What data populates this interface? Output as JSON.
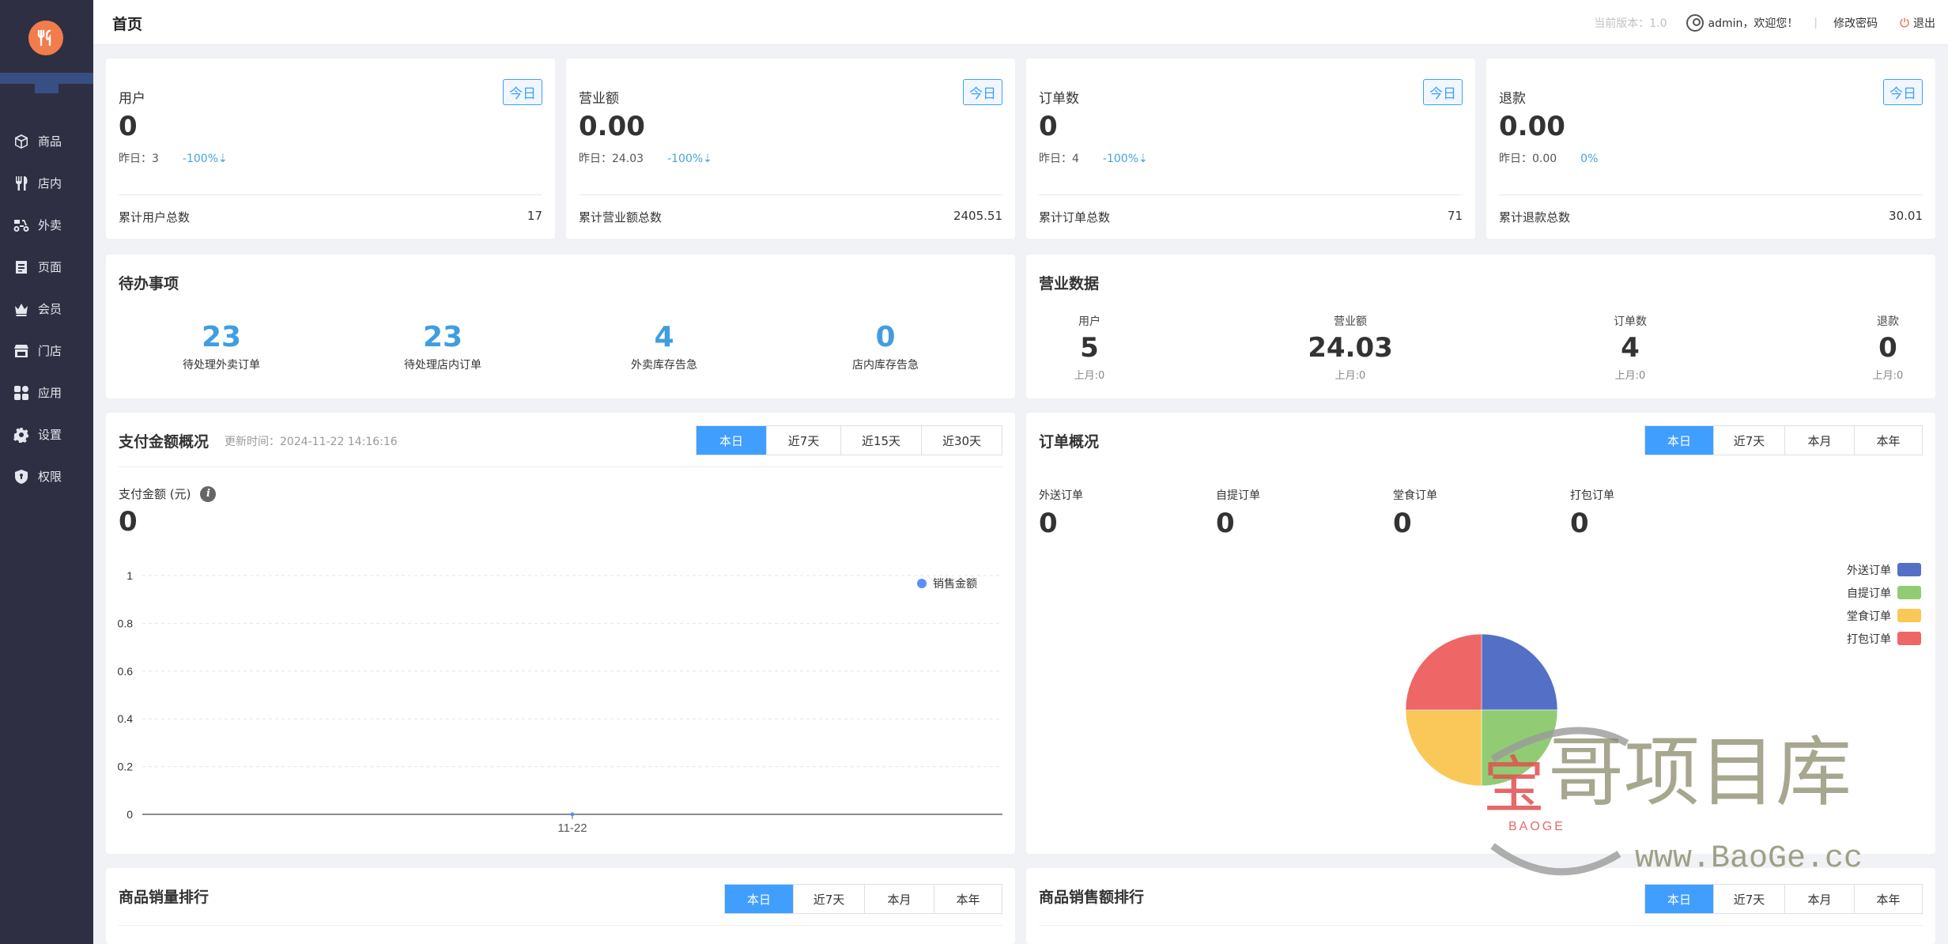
{
  "header": {
    "title": "首页",
    "version": "当前版本：1.0",
    "greeting": "admin，欢迎您！",
    "change_password": "修改密码",
    "logout": "退出"
  },
  "sidebar": {
    "items": [
      {
        "label": "商品",
        "icon": "box-icon"
      },
      {
        "label": "店内",
        "icon": "utensils-icon"
      },
      {
        "label": "外卖",
        "icon": "scooter-icon"
      },
      {
        "label": "页面",
        "icon": "page-icon"
      },
      {
        "label": "会员",
        "icon": "crown-icon"
      },
      {
        "label": "门店",
        "icon": "store-icon"
      },
      {
        "label": "应用",
        "icon": "apps-icon"
      },
      {
        "label": "设置",
        "icon": "gear-icon"
      },
      {
        "label": "权限",
        "icon": "shield-icon"
      }
    ]
  },
  "stats": [
    {
      "label": "用户",
      "badge": "今日",
      "value": "0",
      "yesterday": "昨日：3",
      "change": "-100%⇣",
      "total_label": "累计用户总数",
      "total": "17"
    },
    {
      "label": "营业额",
      "badge": "今日",
      "value": "0.00",
      "yesterday": "昨日：24.03",
      "change": "-100%⇣",
      "total_label": "累计营业额总数",
      "total": "2405.51"
    },
    {
      "label": "订单数",
      "badge": "今日",
      "value": "0",
      "yesterday": "昨日：4",
      "change": "-100%⇣",
      "total_label": "累计订单总数",
      "total": "71"
    },
    {
      "label": "退款",
      "badge": "今日",
      "value": "0.00",
      "yesterday": "昨日：0.00",
      "change": "0%",
      "total_label": "累计退款总数",
      "total": "30.01"
    }
  ],
  "todo": {
    "title": "待办事项",
    "items": [
      {
        "value": "23",
        "label": "待处理外卖订单"
      },
      {
        "value": "23",
        "label": "待处理店内订单"
      },
      {
        "value": "4",
        "label": "外卖库存告急"
      },
      {
        "value": "0",
        "label": "店内库存告急"
      }
    ]
  },
  "business": {
    "title": "营业数据",
    "items": [
      {
        "label": "用户",
        "value": "5",
        "sub": "上月:0"
      },
      {
        "label": "营业额",
        "value": "24.03",
        "sub": "上月:0"
      },
      {
        "label": "订单数",
        "value": "4",
        "sub": "上月:0"
      },
      {
        "label": "退款",
        "value": "0",
        "sub": "上月:0"
      }
    ]
  },
  "payment": {
    "title": "支付金额概况",
    "updated": "更新时间：2024-11-22 14:16:16",
    "tabs": [
      "本日",
      "近7天",
      "近15天",
      "近30天"
    ],
    "active_tab": 0,
    "amount_label": "支付金额 (元)",
    "amount": "0",
    "info_icon": "i"
  },
  "orders": {
    "title": "订单概况",
    "tabs": [
      "本日",
      "近7天",
      "本月",
      "本年"
    ],
    "active_tab": 0,
    "stats": [
      {
        "label": "外送订单",
        "value": "0"
      },
      {
        "label": "自提订单",
        "value": "0"
      },
      {
        "label": "堂食订单",
        "value": "0"
      },
      {
        "label": "打包订单",
        "value": "0"
      }
    ]
  },
  "sales_rank": {
    "title": "商品销量排行",
    "tabs": [
      "本日",
      "近7天",
      "本月",
      "本年"
    ],
    "active_tab": 0
  },
  "amount_rank": {
    "title": "商品销售额排行",
    "tabs": [
      "本日",
      "近7天",
      "本月",
      "本年"
    ],
    "active_tab": 0
  },
  "watermark": {
    "text": "哥项目库",
    "brand": "BAOGE",
    "url": "www.BaoGe.cc"
  },
  "colors": {
    "accent": "#409eff",
    "sidebar": "#2f2f44",
    "logo": "#f27c4b",
    "change": "#45a3d8"
  },
  "chart_data": [
    {
      "type": "line",
      "title": "",
      "categories": [
        "11-22"
      ],
      "series": [
        {
          "name": "销售金额",
          "values": [
            0
          ],
          "color": "#5b8ff9"
        }
      ],
      "ylim": [
        0,
        1
      ],
      "yticks": [
        "0",
        "0.2",
        "0.4",
        "0.6",
        "0.8",
        "1"
      ],
      "grid": true,
      "legend": "top-right"
    },
    {
      "type": "pie",
      "title": "",
      "categories": [
        "外送订单",
        "自提订单",
        "堂食订单",
        "打包订单"
      ],
      "values": [
        0,
        0,
        0,
        0
      ],
      "display_shares": [
        25,
        25,
        25,
        25
      ],
      "colors": [
        "#5470c6",
        "#91cc75",
        "#fac858",
        "#ee6666"
      ],
      "legend": "top-right"
    }
  ]
}
